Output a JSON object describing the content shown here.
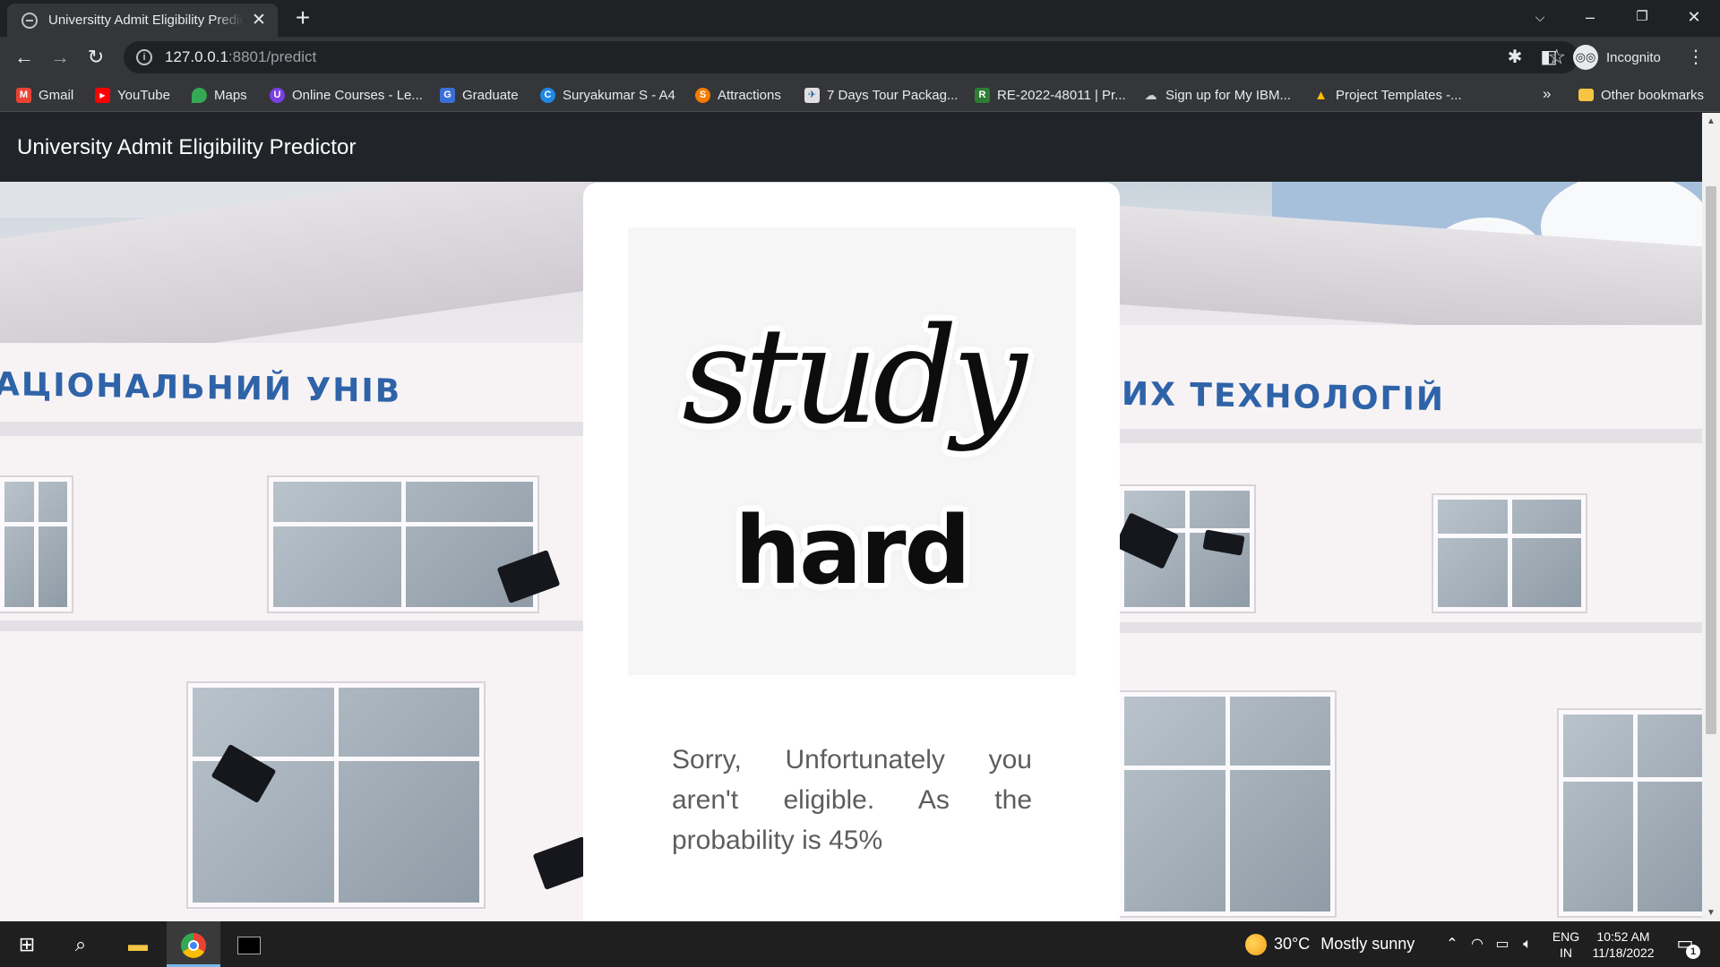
{
  "browser": {
    "tab_title": "Universitty Admit Eligibility Predictor",
    "tab_close": "✕",
    "new_tab": "+",
    "url_host": "127.0.0.1",
    "url_path": ":8801/predict",
    "profile_label": "Incognito"
  },
  "bookmarks": [
    {
      "label": "Gmail",
      "icon": "gmail-icon",
      "color": "#ea4335",
      "glyph": "M"
    },
    {
      "label": "YouTube",
      "icon": "youtube-icon",
      "color": "#ff0000",
      "glyph": "▶"
    },
    {
      "label": "Maps",
      "icon": "maps-icon",
      "color": "#34a853",
      "glyph": "●"
    },
    {
      "label": "Online Courses - Le...",
      "icon": "courses-icon",
      "color": "#7b3fe4",
      "glyph": "U"
    },
    {
      "label": "Graduate",
      "icon": "graduate-icon",
      "color": "#3b6fd8",
      "glyph": "G"
    },
    {
      "label": "Suryakumar S - A4",
      "icon": "canva-icon",
      "color": "#1e88e5",
      "glyph": "C"
    },
    {
      "label": "Attractions",
      "icon": "attractions-icon",
      "color": "#f57c00",
      "glyph": "S"
    },
    {
      "label": "7 Days Tour Packag...",
      "icon": "tour-icon",
      "color": "#e0e0e0",
      "glyph": "✈"
    },
    {
      "label": "RE-2022-48011 | Pr...",
      "icon": "re-icon",
      "color": "#2e7d32",
      "glyph": "R"
    },
    {
      "label": "Sign up for My IBM...",
      "icon": "ibm-icon",
      "color": "#444444",
      "glyph": "☁"
    },
    {
      "label": "Project Templates -...",
      "icon": "drive-icon",
      "color": "#fbbc04",
      "glyph": "▲"
    }
  ],
  "bookmarks_overflow": "»",
  "other_bookmarks": "Other bookmarks",
  "site": {
    "brand": "University Admit Eligibility Predictor",
    "illustration_line1": "study",
    "illustration_line2": "hard",
    "sign_left": "АЦІОНАЛЬНИЙ УНІВ",
    "sign_right": "ИХ ТЕХНОЛОГІЙ",
    "result_text": "Sorry, Unfortunately you aren't eligible. As the probability is 45%"
  },
  "taskbar": {
    "weather_temp": "30°C",
    "weather_desc": "Mostly sunny",
    "lang_top": "ENG",
    "lang_bottom": "IN",
    "time": "10:52 AM",
    "date": "11/18/2022",
    "notification_count": "1"
  }
}
